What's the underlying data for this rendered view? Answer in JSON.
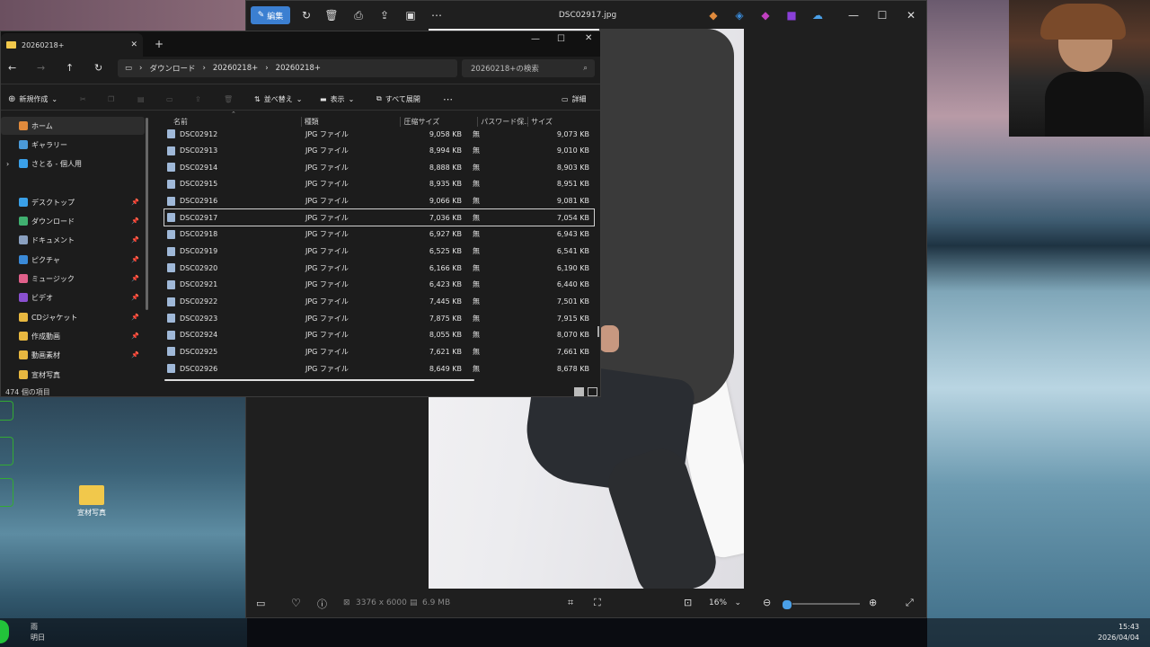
{
  "photos": {
    "filename": "DSC02917.jpg",
    "edit_label": "編集",
    "dimensions": "3376 x 6000",
    "filesize": "6.9 MB",
    "zoom": "16%",
    "zoom_level": 0.02
  },
  "explorer": {
    "tab_title": "20260218+",
    "breadcrumb": [
      "ダウンロード",
      "20260218+",
      "20260218+"
    ],
    "search_placeholder": "20260218+の検索",
    "toolbar": {
      "new": "新規作成",
      "sort": "並べ替え",
      "view": "表示",
      "expand_all": "すべて展開",
      "details": "詳細"
    },
    "columns": {
      "name": "名前",
      "type": "種類",
      "compressed": "圧縮サイズ",
      "password": "パスワード保...",
      "size": "サイズ"
    },
    "rows": [
      {
        "name": "DSC02912",
        "type": "JPG ファイル",
        "compressed": "9,058 KB",
        "password": "無",
        "size": "9,073 KB"
      },
      {
        "name": "DSC02913",
        "type": "JPG ファイル",
        "compressed": "8,994 KB",
        "password": "無",
        "size": "9,010 KB"
      },
      {
        "name": "DSC02914",
        "type": "JPG ファイル",
        "compressed": "8,888 KB",
        "password": "無",
        "size": "8,903 KB"
      },
      {
        "name": "DSC02915",
        "type": "JPG ファイル",
        "compressed": "8,935 KB",
        "password": "無",
        "size": "8,951 KB"
      },
      {
        "name": "DSC02916",
        "type": "JPG ファイル",
        "compressed": "9,066 KB",
        "password": "無",
        "size": "9,081 KB"
      },
      {
        "name": "DSC02917",
        "type": "JPG ファイル",
        "compressed": "7,036 KB",
        "password": "無",
        "size": "7,054 KB"
      },
      {
        "name": "DSC02918",
        "type": "JPG ファイル",
        "compressed": "6,927 KB",
        "password": "無",
        "size": "6,943 KB"
      },
      {
        "name": "DSC02919",
        "type": "JPG ファイル",
        "compressed": "6,525 KB",
        "password": "無",
        "size": "6,541 KB"
      },
      {
        "name": "DSC02920",
        "type": "JPG ファイル",
        "compressed": "6,166 KB",
        "password": "無",
        "size": "6,190 KB"
      },
      {
        "name": "DSC02921",
        "type": "JPG ファイル",
        "compressed": "6,423 KB",
        "password": "無",
        "size": "6,440 KB"
      },
      {
        "name": "DSC02922",
        "type": "JPG ファイル",
        "compressed": "7,445 KB",
        "password": "無",
        "size": "7,501 KB"
      },
      {
        "name": "DSC02923",
        "type": "JPG ファイル",
        "compressed": "7,875 KB",
        "password": "無",
        "size": "7,915 KB"
      },
      {
        "name": "DSC02924",
        "type": "JPG ファイル",
        "compressed": "8,055 KB",
        "password": "無",
        "size": "8,070 KB"
      },
      {
        "name": "DSC02925",
        "type": "JPG ファイル",
        "compressed": "7,621 KB",
        "password": "無",
        "size": "7,661 KB"
      },
      {
        "name": "DSC02926",
        "type": "JPG ファイル",
        "compressed": "8,649 KB",
        "password": "無",
        "size": "8,678 KB"
      }
    ],
    "sidebar": [
      {
        "label": "ホーム",
        "color": "#e08a3c"
      },
      {
        "label": "ギャラリー",
        "color": "#4a9ad8"
      },
      {
        "label": "さとる - 個人用",
        "color": "#3aa0e8"
      },
      {
        "label": "デスクトップ",
        "color": "#3aa0e8"
      },
      {
        "label": "ダウンロード",
        "color": "#40b070"
      },
      {
        "label": "ドキュメント",
        "color": "#8aa0c0"
      },
      {
        "label": "ピクチャ",
        "color": "#3a8ad8"
      },
      {
        "label": "ミュージック",
        "color": "#e0608a"
      },
      {
        "label": "ビデオ",
        "color": "#8a50d0"
      },
      {
        "label": "CDジャケット",
        "color": "#e8b840"
      },
      {
        "label": "作成動画",
        "color": "#e8b840"
      },
      {
        "label": "動画素材",
        "color": "#e8b840"
      },
      {
        "label": "宣材写真",
        "color": "#e8b840"
      }
    ],
    "status": "474 個の項目"
  },
  "desktop": {
    "folder_label": "宣材写真",
    "taskbar_left_top": "雨",
    "taskbar_left_bottom": "明日",
    "time": "15:43",
    "date": "2026/04/04"
  }
}
